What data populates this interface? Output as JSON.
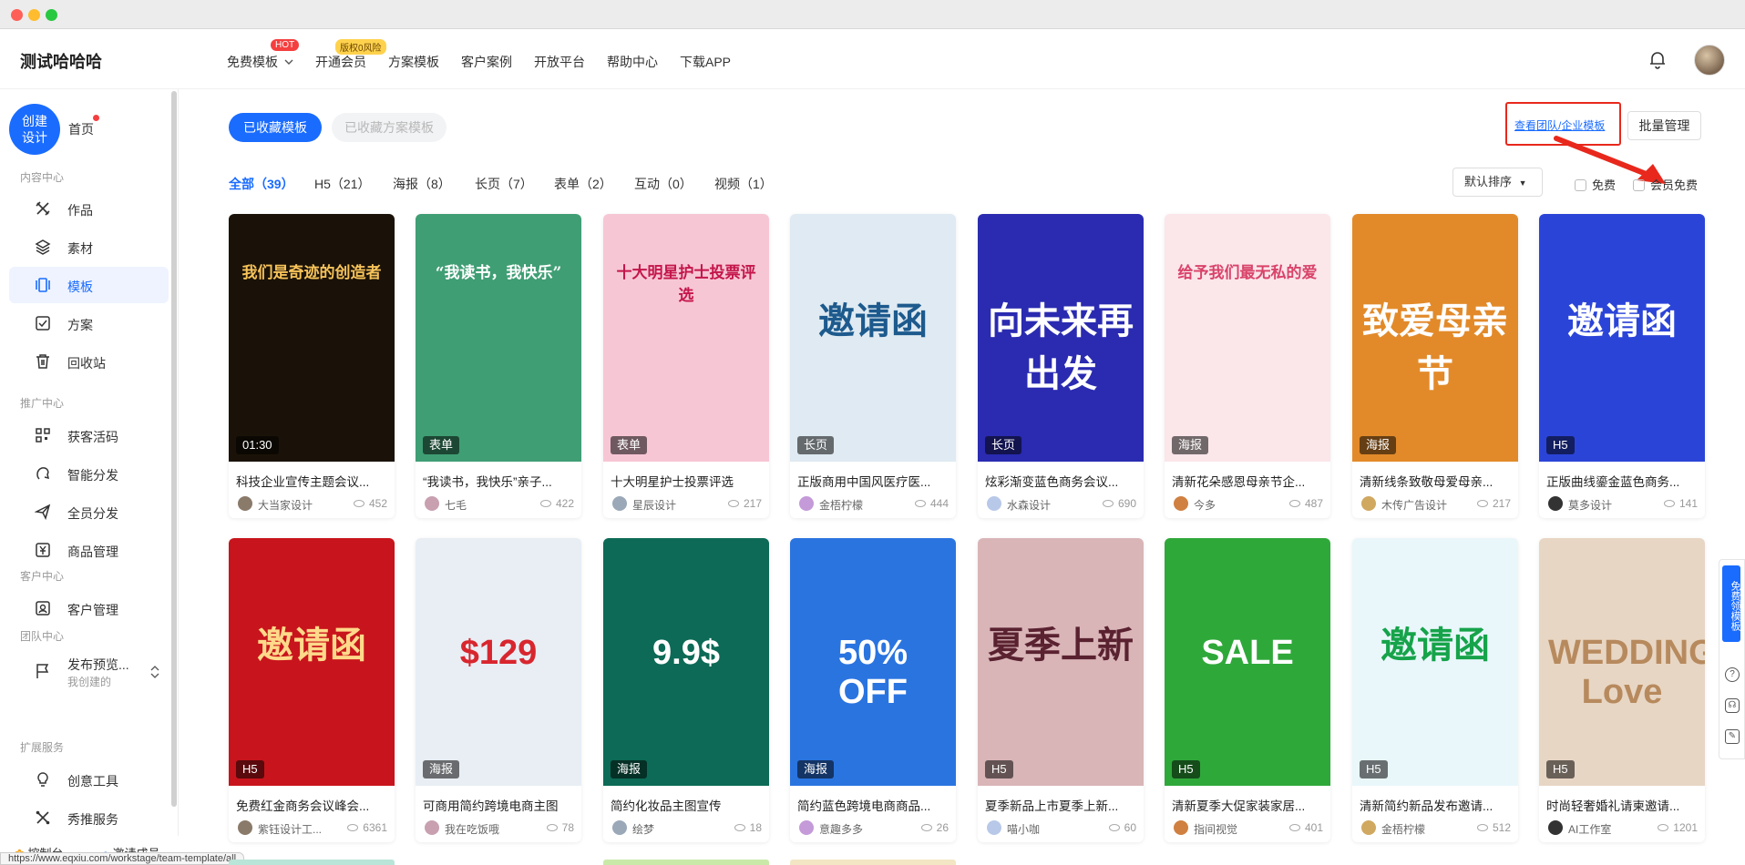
{
  "app": {
    "title": "测试哈哈哈"
  },
  "nav": {
    "items": [
      {
        "label": "免费模板",
        "badge": "HOT"
      },
      {
        "label": "开通会员",
        "badge": "版权0风险"
      },
      {
        "label": "方案模板"
      },
      {
        "label": "客户案例"
      },
      {
        "label": "开放平台"
      },
      {
        "label": "帮助中心"
      },
      {
        "label": "下载APP"
      }
    ]
  },
  "sidebar": {
    "create_label": "创建设计",
    "home_label": "首页",
    "sections": {
      "content": "内容中心",
      "promo": "推广中心",
      "customer": "客户中心",
      "team": "团队中心",
      "ext": "扩展服务"
    },
    "items": {
      "works": "作品",
      "material": "素材",
      "template": "模板",
      "plan": "方案",
      "recycle": "回收站",
      "leads": "获客活码",
      "smart": "智能分发",
      "staff": "全员分发",
      "goods": "商品管理",
      "crm": "客户管理",
      "publish": "发布预览...",
      "publish_sub": "我创建的",
      "creative": "创意工具",
      "service": "秀推服务"
    },
    "bottom": {
      "console": "控制台",
      "invite": "邀请成员"
    }
  },
  "status_url": "https://www.eqxiu.com/workstage/team-template/all",
  "main": {
    "tabs": {
      "active": "已收藏模板",
      "inactive": "已收藏方案模板"
    },
    "team_link": "查看团队/企业模板",
    "batch": "批量管理",
    "filters": [
      {
        "label": "全部",
        "count": "（39）"
      },
      {
        "label": "H5",
        "count": "（21）"
      },
      {
        "label": "海报",
        "count": "（8）"
      },
      {
        "label": "长页",
        "count": "（7）"
      },
      {
        "label": "表单",
        "count": "（2）"
      },
      {
        "label": "互动",
        "count": "（0）"
      },
      {
        "label": "视频",
        "count": "（1）"
      }
    ],
    "sort": "默认排序",
    "chk_free": "免费",
    "chk_member": "会员免费"
  },
  "cards": [
    {
      "title": "科技企业宣传主题会议...",
      "author": "大当家设计",
      "views": "452",
      "tag": "01:30",
      "thumb_text": "我们是奇迹的创造者",
      "bg": "#1a1208",
      "fg": "#f7c35a"
    },
    {
      "title": "“我读书，我快乐”亲子...",
      "author": "七毛",
      "views": "422",
      "tag": "表单",
      "thumb_text": "“我读书，我快乐”",
      "bg": "#3f9e74",
      "fg": "#ffffff"
    },
    {
      "title": "十大明星护士投票评选",
      "author": "星辰设计",
      "views": "217",
      "tag": "表单",
      "thumb_text": "十大明星护士投票评选",
      "bg": "#f7c6d5",
      "fg": "#c4164b"
    },
    {
      "title": "正版商用中国风医疗医...",
      "author": "金梧柠檬",
      "views": "444",
      "tag": "长页",
      "thumb_text": "邀请函",
      "bg": "#dfeaf2",
      "fg": "#1d5a8d"
    },
    {
      "title": "炫彩渐变蓝色商务会议...",
      "author": "水森设计",
      "views": "690",
      "tag": "长页",
      "thumb_text": "向未来再出发",
      "bg": "#2a2bb0",
      "fg": "#ffffff"
    },
    {
      "title": "清新花朵感恩母亲节企...",
      "author": "今多",
      "views": "487",
      "tag": "海报",
      "thumb_text": "给予我们最无私的爱",
      "bg": "#fbe6ea",
      "fg": "#d9436a"
    },
    {
      "title": "清新线条致敬母爱母亲...",
      "author": "木传广告设计",
      "views": "217",
      "tag": "海报",
      "thumb_text": "致爱母亲节",
      "bg": "#e28a2a",
      "fg": "#ffffff"
    },
    {
      "title": "正版曲线鎏金蓝色商务...",
      "author": "莫多设计",
      "views": "141",
      "tag": "H5",
      "thumb_text": "邀请函",
      "bg": "#2b44d8",
      "fg": "#ffffff"
    },
    {
      "title": "免费红金商务会议峰会...",
      "author": "紫钰设计工...",
      "views": "6361",
      "tag": "H5",
      "thumb_text": "邀请函",
      "bg": "#c8141c",
      "fg": "#ffd98a"
    },
    {
      "title": "可商用简约跨境电商主图",
      "author": "我在吃饭哦",
      "views": "78",
      "tag": "海报",
      "thumb_text": "$129",
      "bg": "#e8eef4",
      "fg": "#d8262e"
    },
    {
      "title": "简约化妆品主图宣传",
      "author": "绘梦",
      "views": "18",
      "tag": "海报",
      "thumb_text": "9.9$",
      "bg": "#0c6a56",
      "fg": "#ffffff"
    },
    {
      "title": "简约蓝色跨境电商商品...",
      "author": "意趣多多",
      "views": "26",
      "tag": "海报",
      "thumb_text": "50% OFF",
      "bg": "#2a74e0",
      "fg": "#ffffff"
    },
    {
      "title": "夏季新品上市夏季上新...",
      "author": "喵小咖",
      "views": "60",
      "tag": "H5",
      "thumb_text": "夏季上新",
      "bg": "#d9b5b8",
      "fg": "#5a2230"
    },
    {
      "title": "清新夏季大促家装家居...",
      "author": "指间视觉",
      "views": "401",
      "tag": "H5",
      "thumb_text": "SALE",
      "bg": "#2fa83a",
      "fg": "#ffffff"
    },
    {
      "title": "清新简约新品发布邀请...",
      "author": "金梧柠檬",
      "views": "512",
      "tag": "H5",
      "thumb_text": "邀请函",
      "bg": "#e9f7fb",
      "fg": "#16a34a"
    },
    {
      "title": "时尚轻奢婚礼请柬邀请...",
      "author": "AI工作室",
      "views": "1201",
      "tag": "H5",
      "thumb_text": "WEDDING Love",
      "bg": "#e8d6c4",
      "fg": "#b78a5e"
    }
  ],
  "rightbar": {
    "free": "免费领模板"
  },
  "colors": {
    "accent": "#1a6cff",
    "highlight": "#e8281c"
  }
}
